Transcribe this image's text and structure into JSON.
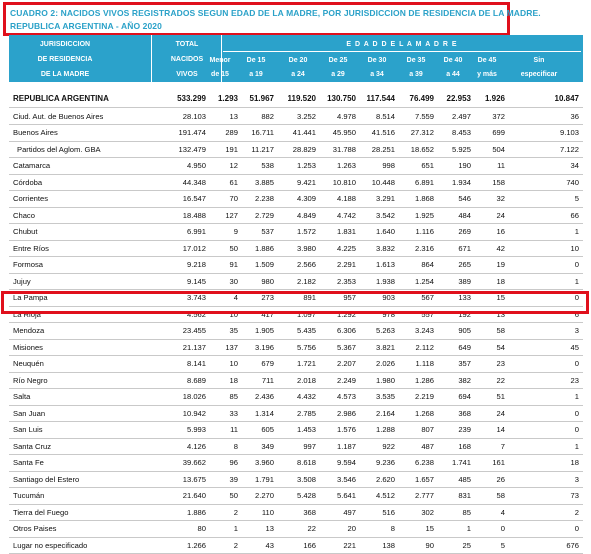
{
  "title": {
    "line1": "CUADRO 2: NACIDOS VIVOS REGISTRADOS SEGUN EDAD DE LA MADRE, POR JURISDICCION DE RESIDENCIA DE LA MADRE.",
    "line2": "REPUBLICA ARGENTINA - AÑO 2020"
  },
  "header": {
    "jurisdiccion": [
      "JURISDICCION",
      "DE RESIDENCIA",
      "DE LA MADRE"
    ],
    "total": [
      "TOTAL",
      "NACIDOS",
      "VIVOS"
    ],
    "edad": "E D A D   D E   L A   M A D R E",
    "cols": [
      [
        "Menor",
        "de 15"
      ],
      [
        "De 15",
        "a 19"
      ],
      [
        "De 20",
        "a 24"
      ],
      [
        "De 25",
        "a 29"
      ],
      [
        "De 30",
        "a 34"
      ],
      [
        "De 35",
        "a 39"
      ],
      [
        "De 40",
        "a 44"
      ],
      [
        "De 45",
        "y más"
      ],
      [
        "Sin",
        "especificar"
      ]
    ]
  },
  "rows": [
    {
      "name": "REPUBLICA ARGENTINA",
      "v": [
        "533.299",
        "1.293",
        "51.967",
        "119.520",
        "130.750",
        "117.544",
        "76.499",
        "22.953",
        "1.926",
        "10.847"
      ]
    },
    {
      "name": "Ciud. Aut. de  Buenos Aires",
      "v": [
        "28.103",
        "13",
        "882",
        "3.252",
        "4.978",
        "8.514",
        "7.559",
        "2.497",
        "372",
        "36"
      ]
    },
    {
      "name": "Buenos Aires",
      "v": [
        "191.474",
        "289",
        "16.711",
        "41.441",
        "45.950",
        "41.516",
        "27.312",
        "8.453",
        "699",
        "9.103"
      ]
    },
    {
      "name": "Partidos del Aglom. GBA",
      "v": [
        "132.479",
        "191",
        "11.217",
        "28.829",
        "31.788",
        "28.251",
        "18.652",
        "5.925",
        "504",
        "7.122"
      ]
    },
    {
      "name": "Catamarca",
      "v": [
        "4.950",
        "12",
        "538",
        "1.253",
        "1.263",
        "998",
        "651",
        "190",
        "11",
        "34"
      ]
    },
    {
      "name": "Córdoba",
      "v": [
        "44.348",
        "61",
        "3.885",
        "9.421",
        "10.810",
        "10.448",
        "6.891",
        "1.934",
        "158",
        "740"
      ]
    },
    {
      "name": "Corrientes",
      "v": [
        "16.547",
        "70",
        "2.238",
        "4.309",
        "4.188",
        "3.291",
        "1.868",
        "546",
        "32",
        "5"
      ]
    },
    {
      "name": "Chaco",
      "v": [
        "18.488",
        "127",
        "2.729",
        "4.849",
        "4.742",
        "3.542",
        "1.925",
        "484",
        "24",
        "66"
      ]
    },
    {
      "name": "Chubut",
      "v": [
        "6.991",
        "9",
        "537",
        "1.572",
        "1.831",
        "1.640",
        "1.116",
        "269",
        "16",
        "1"
      ]
    },
    {
      "name": "Entre Ríos",
      "v": [
        "17.012",
        "50",
        "1.886",
        "3.980",
        "4.225",
        "3.832",
        "2.316",
        "671",
        "42",
        "10"
      ]
    },
    {
      "name": "Formosa",
      "v": [
        "9.218",
        "91",
        "1.509",
        "2.566",
        "2.291",
        "1.613",
        "864",
        "265",
        "19",
        "0"
      ]
    },
    {
      "name": "Jujuy",
      "v": [
        "9.145",
        "30",
        "980",
        "2.182",
        "2.353",
        "1.938",
        "1.254",
        "389",
        "18",
        "1"
      ]
    },
    {
      "name": "La Pampa",
      "v": [
        "3.743",
        "4",
        "273",
        "891",
        "957",
        "903",
        "567",
        "133",
        "15",
        "0"
      ]
    },
    {
      "name": "La Rioja",
      "v": [
        "4.562",
        "10",
        "417",
        "1.097",
        "1.292",
        "978",
        "557",
        "192",
        "13",
        "6"
      ]
    },
    {
      "name": "Mendoza",
      "v": [
        "23.455",
        "35",
        "1.905",
        "5.435",
        "6.306",
        "5.263",
        "3.243",
        "905",
        "58",
        "3"
      ]
    },
    {
      "name": "Misiones",
      "v": [
        "21.137",
        "137",
        "3.196",
        "5.756",
        "5.367",
        "3.821",
        "2.112",
        "649",
        "54",
        "45"
      ]
    },
    {
      "name": "Neuquén",
      "v": [
        "8.141",
        "10",
        "679",
        "1.721",
        "2.207",
        "2.026",
        "1.118",
        "357",
        "23",
        "0"
      ]
    },
    {
      "name": "Río Negro",
      "v": [
        "8.689",
        "18",
        "711",
        "2.018",
        "2.249",
        "1.980",
        "1.286",
        "382",
        "22",
        "23"
      ]
    },
    {
      "name": "Salta",
      "v": [
        "18.026",
        "85",
        "2.436",
        "4.432",
        "4.573",
        "3.535",
        "2.219",
        "694",
        "51",
        "1"
      ]
    },
    {
      "name": "San Juan",
      "v": [
        "10.942",
        "33",
        "1.314",
        "2.785",
        "2.986",
        "2.164",
        "1.268",
        "368",
        "24",
        "0"
      ]
    },
    {
      "name": "San Luis",
      "v": [
        "5.993",
        "11",
        "605",
        "1.453",
        "1.576",
        "1.288",
        "807",
        "239",
        "14",
        "0"
      ]
    },
    {
      "name": "Santa Cruz",
      "v": [
        "4.126",
        "8",
        "349",
        "997",
        "1.187",
        "922",
        "487",
        "168",
        "7",
        "1"
      ]
    },
    {
      "name": "Santa Fe",
      "v": [
        "39.662",
        "96",
        "3.960",
        "8.618",
        "9.594",
        "9.236",
        "6.238",
        "1.741",
        "161",
        "18"
      ]
    },
    {
      "name": "Santiago del Estero",
      "v": [
        "13.675",
        "39",
        "1.791",
        "3.508",
        "3.546",
        "2.620",
        "1.657",
        "485",
        "26",
        "3"
      ]
    },
    {
      "name": "Tucumán",
      "v": [
        "21.640",
        "50",
        "2.270",
        "5.428",
        "5.641",
        "4.512",
        "2.777",
        "831",
        "58",
        "73"
      ]
    },
    {
      "name": "Tierra del Fuego",
      "v": [
        "1.886",
        "2",
        "110",
        "368",
        "497",
        "516",
        "302",
        "85",
        "4",
        "2"
      ]
    },
    {
      "name": "Otros Paises",
      "v": [
        "80",
        "1",
        "13",
        "22",
        "20",
        "8",
        "15",
        "1",
        "0",
        "0"
      ]
    },
    {
      "name": "Lugar no especificado",
      "v": [
        "1.266",
        "2",
        "43",
        "166",
        "221",
        "138",
        "90",
        "25",
        "5",
        "676"
      ]
    }
  ],
  "colors": {
    "header_bg": "#2ba2cb",
    "highlight": "#e0101c",
    "title_text": "#2aa1c8"
  }
}
